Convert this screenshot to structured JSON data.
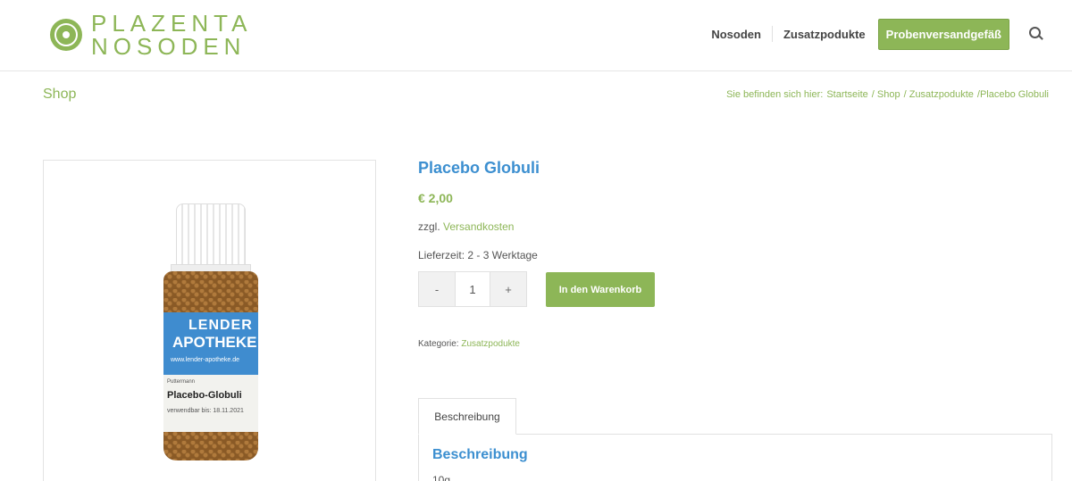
{
  "header": {
    "logo": {
      "line1": "PLAZENTA",
      "line2": "NOSODEN"
    },
    "nav": {
      "items": [
        "Nosoden",
        "Zusatzpodukte"
      ],
      "cta": "Probenversandgefäß"
    }
  },
  "title_bar": {
    "title": "Shop",
    "breadcrumb": {
      "prefix": "Sie befinden sich hier:",
      "items": [
        "Startseite",
        "/ Shop",
        "/ Zusatzpodukte",
        "/Placebo Globuli"
      ]
    }
  },
  "product": {
    "image_label": {
      "brand_line1": "LENDER",
      "brand_line2": "APOTHEKE",
      "url": "www.lender-apotheke.de",
      "maker": "Puttermann",
      "name": "Placebo-Globuli",
      "expiry": "verwendbar bis: 18.11.2021"
    },
    "title": "Placebo Globuli",
    "price": "€ 2,00",
    "shipping_prefix": "zzgl.",
    "shipping_link": "Versandkosten",
    "delivery": "Lieferzeit: 2 - 3 Werktage",
    "quantity": {
      "minus": "-",
      "value": "1",
      "plus": "+"
    },
    "add_to_cart": "In den Warenkorb",
    "category_prefix": "Kategorie:",
    "category_link": "Zusatzpodukte"
  },
  "tabs": {
    "items": [
      "Beschreibung"
    ],
    "panel_heading": "Beschreibung",
    "panel_text": "10g"
  },
  "colors": {
    "brand_green": "#8db657",
    "title_blue": "#3c8fd0"
  },
  "icons": [
    "logo-mark-icon",
    "search-icon"
  ]
}
